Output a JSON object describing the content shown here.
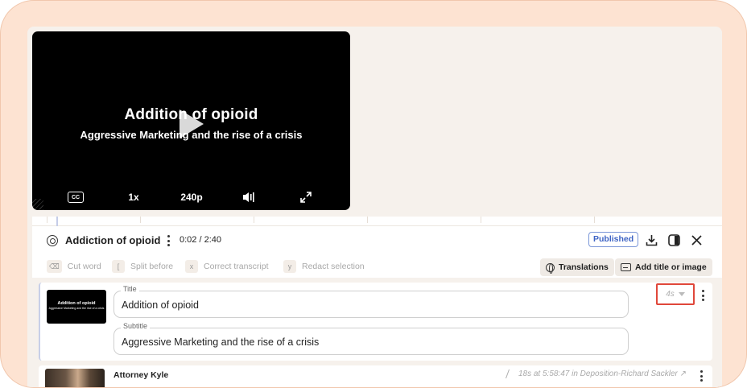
{
  "video": {
    "title": "Addition of opioid",
    "subtitle": "Aggressive Marketing and the rise of a crisis",
    "cc_label": "CC",
    "speed": "1x",
    "quality": "240p",
    "icons": [
      "play-icon",
      "volume-icon",
      "fullscreen-icon"
    ]
  },
  "header": {
    "title": "Addiction of opioid",
    "time": "0:02 / 2:40",
    "status": "Published",
    "icons": [
      "transcript-icon",
      "more-icon",
      "download-icon",
      "split-view-icon",
      "close-icon"
    ]
  },
  "toolbar": {
    "tools": [
      {
        "key": "⌫",
        "label": "Cut word"
      },
      {
        "key": "[",
        "label": "Split before"
      },
      {
        "key": "x",
        "label": "Correct transcript"
      },
      {
        "key": "y",
        "label": "Redact selection"
      }
    ],
    "translations_label": "Translations",
    "add_title_label": "Add title or image"
  },
  "title_card": {
    "thumb_title": "Addition of opioid",
    "thumb_subtitle": "Aggressive Marketing and the rise of a crisis",
    "title_label": "Title",
    "title_value": "Addition of opioid",
    "subtitle_label": "Subtitle",
    "subtitle_value": "Aggressive Marketing and the rise of a crisis",
    "duration": "4s"
  },
  "clip_card": {
    "speaker": "Attorney Kyle",
    "meta": "18s at 5:58:47 in Deposition-Richard Sackler ↗"
  },
  "colors": {
    "frame": "#fde3d2",
    "accent_blue": "#3d63c4",
    "highlight_red": "#e0473a"
  }
}
